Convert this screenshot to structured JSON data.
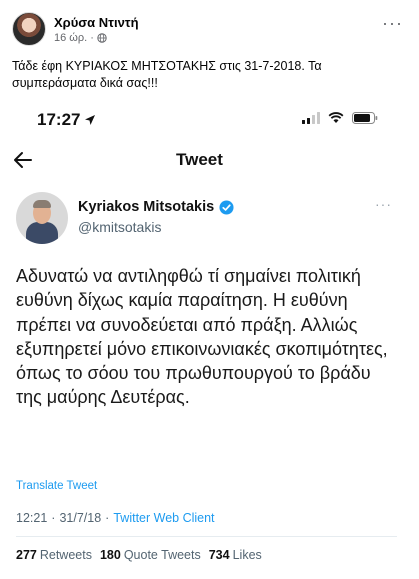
{
  "post": {
    "author": "Χρύσα Ντιντή",
    "time": "16 ώρ.",
    "separator": "·",
    "text": "Τάδε έφη ΚΥΡΙΑΚΟΣ ΜΗΤΣΟΤΑΚΗΣ στις 31-7-2018. Τα συμπεράσματα δικά σας!!!",
    "more_label": "···"
  },
  "phone": {
    "time": "17:27"
  },
  "tweet_nav": {
    "title": "Tweet"
  },
  "tweet": {
    "display_name": "Kyriakos Mitsotakis",
    "handle": "@kmitsotakis",
    "more_label": "···",
    "body": "Αδυνατώ να αντιληφθώ τί σημαίνει πολιτική ευθύνη δίχως καμία παραίτηση. Η ευθύνη πρέπει να συνοδεύεται από πράξη. Αλλιώς εξυπηρετεί μόνο επικοινωνιακές σκοπιμότητες, όπως το σόου του πρωθυπουργού το βράδυ της μαύρης Δευτέρας.",
    "translate": "Translate Tweet",
    "time": "12:21",
    "date": "31/7/18",
    "dot": "·",
    "client": "Twitter Web Client",
    "stats": [
      {
        "count": "277",
        "label": "Retweets"
      },
      {
        "count": "180",
        "label": "Quote Tweets"
      },
      {
        "count": "734",
        "label": "Likes"
      }
    ]
  },
  "colors": {
    "twitter_blue": "#1d9bf0",
    "facebook_gray": "#65676b"
  }
}
